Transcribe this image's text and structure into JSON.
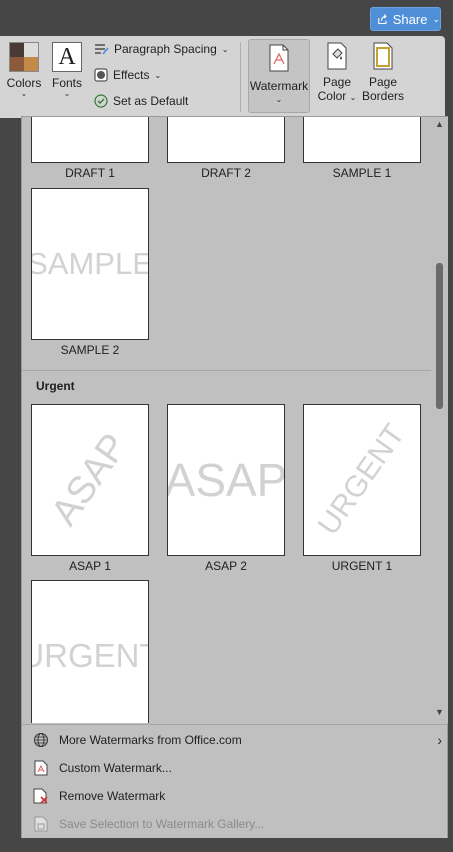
{
  "header": {
    "share_label": "Share"
  },
  "ribbon": {
    "colors_label": "Colors",
    "fonts_label": "Fonts",
    "fonts_glyph": "A",
    "paragraph_spacing_label": "Paragraph Spacing",
    "effects_label": "Effects",
    "set_default_label": "Set as Default",
    "watermark_label": "Watermark",
    "page_color_label_1": "Page",
    "page_color_label_2": "Color",
    "page_borders_label_1": "Page",
    "page_borders_label_2": "Borders"
  },
  "gallery": {
    "row1": [
      {
        "label": "DRAFT 1"
      },
      {
        "label": "DRAFT 2"
      },
      {
        "label": "SAMPLE 1"
      }
    ],
    "sample2": {
      "label": "SAMPLE 2",
      "text": "SAMPLE"
    },
    "urgent_section": "Urgent",
    "row3": [
      {
        "label": "ASAP 1",
        "text": "ASAP"
      },
      {
        "label": "ASAP 2",
        "text": "ASAP"
      },
      {
        "label": "URGENT 1",
        "text": "URGENT"
      }
    ],
    "urgent2": {
      "text": "URGENT"
    }
  },
  "menu": {
    "more": "More Watermarks from Office.com",
    "custom": "Custom Watermark...",
    "remove": "Remove Watermark",
    "save": "Save Selection to Watermark Gallery..."
  },
  "colors": {
    "accent": "#4f8fd8",
    "panel": "#c0c0c0",
    "ribbon": "#d4d4d4"
  }
}
